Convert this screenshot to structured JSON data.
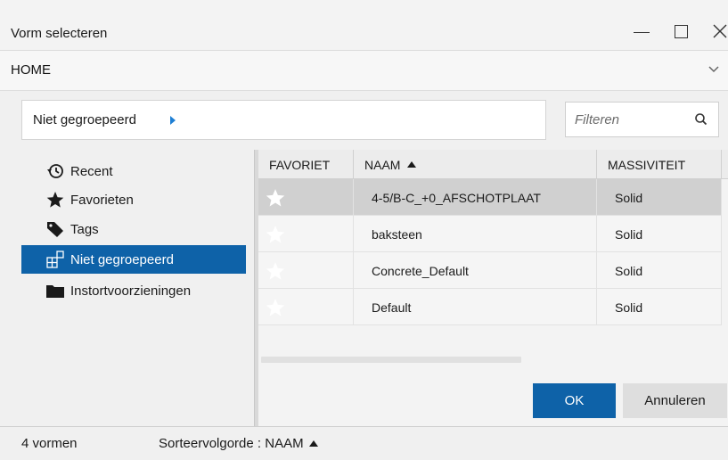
{
  "window": {
    "title": "Vorm selecteren"
  },
  "location": {
    "current": "HOME"
  },
  "breadcrumb": {
    "label": "Niet gegroepeerd"
  },
  "filter": {
    "placeholder": "Filteren",
    "value": ""
  },
  "sidebar": {
    "items": [
      {
        "label": "Recent",
        "icon": "history-icon",
        "selected": false
      },
      {
        "label": "Favorieten",
        "icon": "star-icon",
        "selected": false
      },
      {
        "label": "Tags",
        "icon": "tag-icon",
        "selected": false
      },
      {
        "label": "Niet gegroepeerd",
        "icon": "ungrouped-icon",
        "selected": true
      },
      {
        "label": "Instortvoorzieningen",
        "icon": "folder-icon",
        "selected": false
      }
    ]
  },
  "table": {
    "columns": [
      "FAVORIET",
      "NAAM",
      "MASSIVITEIT"
    ],
    "sort_column": "NAAM",
    "sort_direction": "ascending",
    "rows": [
      {
        "favorite": false,
        "name": "4-5/B-C_+0_AFSCHOTPLAAT",
        "massiviteit": "Solid",
        "selected": true
      },
      {
        "favorite": false,
        "name": "baksteen",
        "massiviteit": "Solid",
        "selected": false
      },
      {
        "favorite": false,
        "name": "Concrete_Default",
        "massiviteit": "Solid",
        "selected": false
      },
      {
        "favorite": false,
        "name": "Default",
        "massiviteit": "Solid",
        "selected": false
      }
    ]
  },
  "buttons": {
    "ok": "OK",
    "cancel": "Annuleren"
  },
  "status": {
    "count": "4 vormen",
    "sort": "Sorteervolgorde : NAAM"
  },
  "colors": {
    "accent": "#0e62a8",
    "breadcrumb_arrow": "#1e7fd4",
    "selected_row": "#d0d0d0"
  }
}
